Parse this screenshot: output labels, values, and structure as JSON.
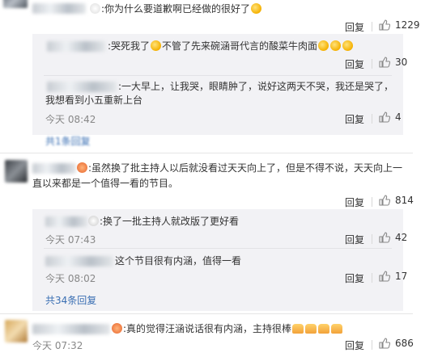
{
  "comments": [
    {
      "text": ":你为什么要道歉啊已经做的很好了",
      "reply_label": "回复",
      "likes": "1229",
      "replies": [
        {
          "text": ":哭死我了",
          "text2": "不管了先来碗涵哥代言的酸菜牛肉面",
          "reply_label": "回复",
          "likes": "30"
        },
        {
          "text": ":一大早上，让我哭，眼睛肿了，说好这两天不哭，我还是哭了，",
          "text2": "我想看到小五重新上台",
          "time": "今天 08:42",
          "reply_label": "回复",
          "likes": "4"
        }
      ],
      "more_replies": "共1条回复"
    },
    {
      "text": ":虽然换了批主持人以后就没看过天天向上了，但是不得不说，天天向上一",
      "text2": "直以来都是一个值得一看的节目。",
      "reply_label": "回复",
      "likes": "814",
      "replies": [
        {
          "text": ":换了一批主持人就改版了更好看",
          "time": "今天 07:43",
          "reply_label": "回复",
          "likes": "42"
        },
        {
          "text": "这个节目很有内涵，值得一看",
          "time": "今天 08:02",
          "reply_label": "回复",
          "likes": "17"
        }
      ],
      "more_replies": "共34条回复"
    },
    {
      "text": ":真的觉得汪涵说话很有内涵，主持很棒",
      "time": "今天 07:32",
      "reply_label": "回复",
      "likes": "686"
    }
  ],
  "icons": {
    "like": "thumbs-up-icon",
    "emoji": "crying-face-icon",
    "clap": "clapping-hands-icon"
  },
  "colors": {
    "link": "#eb7350",
    "link_blue": "#3a6fb3",
    "reply_bg": "#f2f2f5"
  }
}
